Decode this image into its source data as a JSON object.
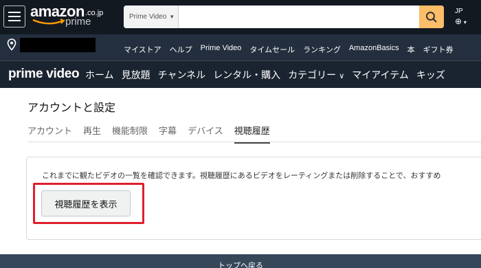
{
  "header": {
    "logo_text": "amazon",
    "logo_suffix": ".co.jp",
    "logo_sub": "prime",
    "search_scope": "Prime Video",
    "search_placeholder": "",
    "language": "JP",
    "nav_links": [
      "マイストア",
      "ヘルプ",
      "Prime Video",
      "タイムセール",
      "ランキング",
      "AmazonBasics",
      "本",
      "ギフト券"
    ]
  },
  "prime_nav": {
    "logo": "prime video",
    "items": [
      "ホーム",
      "見放題",
      "チャンネル",
      "レンタル・購入",
      "カテゴリー",
      "マイアイテム",
      "キッズ"
    ]
  },
  "page": {
    "title": "アカウントと設定",
    "tabs": [
      "アカウント",
      "再生",
      "機能制限",
      "字幕",
      "デバイス",
      "視聴履歴"
    ],
    "active_tab": "視聴履歴",
    "description": "これまでに観たビデオの一覧を確認できます。視聴履歴にあるビデオをレーティングまたは削除することで、おすすめ",
    "view_history_button": "視聴履歴を表示"
  },
  "footer": {
    "back_to_top": "トップへ戻る"
  },
  "colors": {
    "header_bg": "#131921",
    "subbar_bg": "#232f3e",
    "search_button": "#febd69",
    "highlight": "#e01e2e"
  }
}
